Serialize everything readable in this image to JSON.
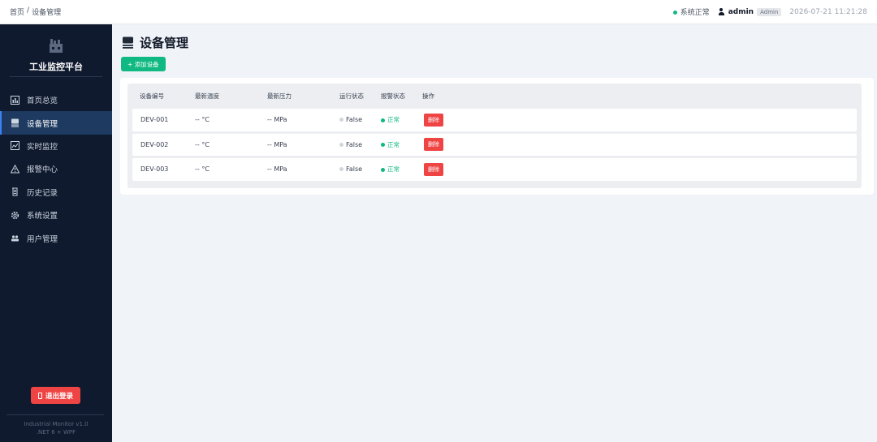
{
  "breadcrumb": {
    "home": "首页",
    "sep": "/",
    "current": "设备管理"
  },
  "topbar": {
    "system_status": "系统正常",
    "username": "admin",
    "role": "Admin",
    "datetime": "2026-07-21 11:21:28"
  },
  "sidebar": {
    "title": "工业监控平台",
    "items": [
      {
        "label": "首页总览",
        "icon": "chart-icon"
      },
      {
        "label": "设备管理",
        "icon": "device-icon",
        "active": true
      },
      {
        "label": "实时监控",
        "icon": "monitor-icon"
      },
      {
        "label": "报警中心",
        "icon": "warning-icon"
      },
      {
        "label": "历史记录",
        "icon": "history-icon"
      },
      {
        "label": "系统设置",
        "icon": "gear-icon"
      },
      {
        "label": "用户管理",
        "icon": "users-icon"
      }
    ],
    "logout_label": "退出登录",
    "footer_line1": "Industrial Monitor v1.0",
    "footer_line2": ".NET 6 + WPF"
  },
  "main": {
    "title": "设备管理",
    "add_button": "+ 添加设备",
    "columns": [
      "设备编号",
      "最新温度",
      "最新压力",
      "运行状态",
      "报警状态",
      "操作"
    ],
    "rows": [
      {
        "id": "DEV-001",
        "temp": "-- °C",
        "pressure": "-- MPa",
        "run": "False",
        "alarm": "正常",
        "action": "删除"
      },
      {
        "id": "DEV-002",
        "temp": "-- °C",
        "pressure": "-- MPa",
        "run": "False",
        "alarm": "正常",
        "action": "删除"
      },
      {
        "id": "DEV-003",
        "temp": "-- °C",
        "pressure": "-- MPa",
        "run": "False",
        "alarm": "正常",
        "action": "删除"
      }
    ]
  },
  "colors": {
    "sidebar_bg": "#101a2e",
    "active_item": "#1e3a60",
    "success": "#10b981",
    "danger": "#ef4444"
  }
}
